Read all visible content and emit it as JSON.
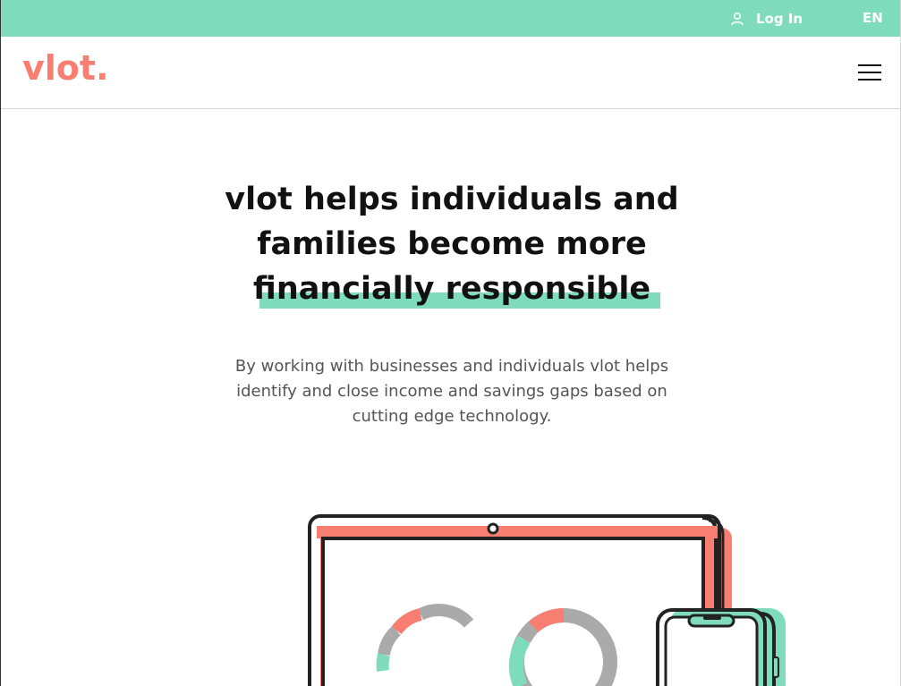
{
  "topbar": {
    "login_label": "Log In",
    "language": "EN",
    "user_icon": "user-icon"
  },
  "header": {
    "logo_text": "vlot.",
    "menu_icon": "hamburger-menu-icon"
  },
  "hero": {
    "title_lines": [
      "vlot helps individuals and",
      "families become more",
      "financially responsible"
    ],
    "subtitle_lines": [
      "By working with businesses and individuals vlot helps",
      "identify and close income and savings gaps based on",
      "cutting edge technology."
    ]
  },
  "colors": {
    "brand_green": "#7edcbd",
    "brand_coral": "#f97e72",
    "text_dark": "#111111"
  }
}
